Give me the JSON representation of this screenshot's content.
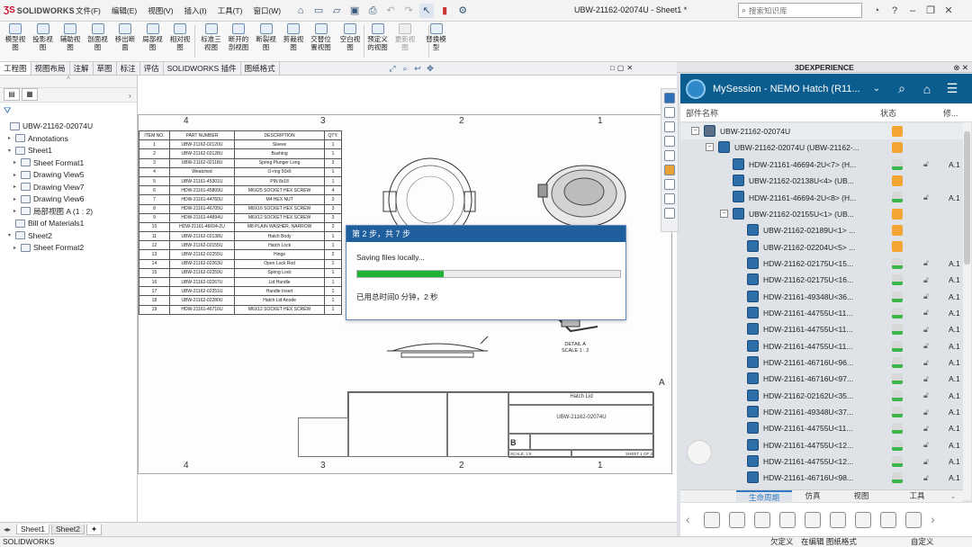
{
  "app": {
    "name": "SOLIDWORKS",
    "doc_title": "UBW-21162-02074U - Sheet1 *"
  },
  "menu": [
    "文件(F)",
    "编辑(E)",
    "视图(V)",
    "插入(I)",
    "工具(T)",
    "窗口(W)"
  ],
  "search": {
    "placeholder": "搜索知识库"
  },
  "commands": [
    {
      "label": "模型视\n图",
      "disabled": false
    },
    {
      "label": "投影视\n图",
      "disabled": false
    },
    {
      "label": "辅助视\n图",
      "disabled": false
    },
    {
      "label": "剖面视\n图",
      "disabled": false
    },
    {
      "label": "移出断\n面",
      "disabled": false
    },
    {
      "label": "局部视\n图",
      "disabled": false
    },
    {
      "label": "相对视\n图",
      "disabled": false
    },
    {
      "label": "标准三\n视图",
      "disabled": false
    },
    {
      "label": "断开的\n剖视图",
      "disabled": false
    },
    {
      "label": "断裂视\n图",
      "disabled": false
    },
    {
      "label": "剪裁视\n图",
      "disabled": false
    },
    {
      "label": "交替位\n置视图",
      "disabled": false
    },
    {
      "label": "空白视\n图",
      "disabled": false
    },
    {
      "label": "预定义\n的视图",
      "disabled": false
    },
    {
      "label": "更新视\n图",
      "disabled": true
    },
    {
      "label": "替换模\n型",
      "disabled": false
    }
  ],
  "tabs": [
    "工程图",
    "视图布局",
    "注解",
    "草图",
    "标注",
    "评估",
    "SOLIDWORKS 插件",
    "图纸格式"
  ],
  "tree": [
    {
      "label": "UBW-21162-02074U",
      "level": 0,
      "toggle": ""
    },
    {
      "label": "Annotations",
      "level": 1,
      "toggle": "▸"
    },
    {
      "label": "Sheet1",
      "level": 1,
      "toggle": "▾"
    },
    {
      "label": "Sheet Format1",
      "level": 2,
      "toggle": "▸"
    },
    {
      "label": "Drawing View5",
      "level": 2,
      "toggle": "▸"
    },
    {
      "label": "Drawing View7",
      "level": 2,
      "toggle": "▸"
    },
    {
      "label": "Drawing View6",
      "level": 2,
      "toggle": "▸"
    },
    {
      "label": "局部视图 A (1 : 2)",
      "level": 2,
      "toggle": "▸"
    },
    {
      "label": "Bill of Materials1",
      "level": 1,
      "toggle": ""
    },
    {
      "label": "Sheet2",
      "level": 1,
      "toggle": "▾"
    },
    {
      "label": "Sheet Format2",
      "level": 2,
      "toggle": "▸"
    }
  ],
  "sheet": {
    "zones_top": [
      "4",
      "3",
      "2",
      "1"
    ],
    "zone_side": "A",
    "bom_headers": [
      "ITEM NO.",
      "PART NUMBER",
      "DESCRIPTION",
      "QTY."
    ],
    "bom_rows": [
      [
        "1",
        "UBW-21162-02120U",
        "Sleeve",
        "1"
      ],
      [
        "2",
        "UBW-21162-02128U",
        "Bushing",
        "1"
      ],
      [
        "3",
        "UBW-21162-02118U",
        "Spring Plunger Long",
        "3"
      ],
      [
        "4",
        "Weatched",
        "O-ring 50x6",
        "1"
      ],
      [
        "5",
        "UBW-21161-45301U",
        "PIN 8x18",
        "1"
      ],
      [
        "6",
        "HDW-21161-45809U",
        "M6X25 SOCKET HEX SCREW",
        "4"
      ],
      [
        "7",
        "HDW-21161-44760U",
        "M4 HEX NUT",
        "3"
      ],
      [
        "8",
        "HDW-21161-46705U",
        "M8X16 SOCKET HEX SCREW",
        "3"
      ],
      [
        "9",
        "HDW-21161-44894U",
        "M6X12 SOCKET HEX SCREW",
        "3"
      ],
      [
        "10",
        "HDW-21161-46694-2U",
        "M8 PLAIN WASHER, NARROW",
        "2"
      ],
      [
        "11",
        "UBW-21162-02138U",
        "Hatch Body",
        "1"
      ],
      [
        "12",
        "UBW-21162-02155U",
        "Hatch Lock",
        "1"
      ],
      [
        "13",
        "UBW-21162-02255U",
        "Hinge",
        "2"
      ],
      [
        "14",
        "UBW-21162-02263U",
        "Open Lock Rod",
        "1"
      ],
      [
        "15",
        "UBW-21162-02259U",
        "Spring Lock",
        "1"
      ],
      [
        "16",
        "UBW-21162-02267U",
        "Lid Handle",
        "1"
      ],
      [
        "17",
        "UBW-21162-02251U",
        "Handle Insert",
        "1"
      ],
      [
        "18",
        "UBW-21162-02280U",
        "Hatch Lid Anode",
        "1"
      ],
      [
        "19",
        "HDW-21161-46716U",
        "M6X12 SOCKET HEX SCREW",
        "1"
      ]
    ],
    "detail_label": "DETAIL A\nSCALE 1 : 2",
    "title_block": {
      "title": "Hatch Lid",
      "dwg": "UBW-21162-02074U",
      "size": "B",
      "sheet": "SHEET 1 OF 2",
      "scale": "SCALE: 1:8"
    }
  },
  "dialog": {
    "title": "第 2 步，共 7 步",
    "message": "Saving files locally...",
    "progress": 0.33,
    "elapsed": "已用总时间0 分钟，2 秒"
  },
  "sheet_tabs": [
    "Sheet1",
    "Sheet2"
  ],
  "status": {
    "left": "SOLIDWORKS",
    "items": [
      "欠定义",
      "在编辑 图纸格式",
      "自定义"
    ]
  },
  "xp": {
    "panel_title": "3DEXPERIENCE",
    "session": "MySession - NEMO Hatch (R11...",
    "columns": {
      "name": "部件名称",
      "status": "状态",
      "rev": "修..."
    },
    "rows": [
      {
        "name": "UBW-21162-02074U",
        "indent": 0,
        "toggle": "−",
        "status": "lk",
        "lock": false,
        "rev": ""
      },
      {
        "name": "UBW-21162-02074U (UBW-21162-...",
        "indent": 1,
        "toggle": "−",
        "status": "lk",
        "lock": false,
        "rev": ""
      },
      {
        "name": "HDW-21161-46694-2U<7> (H...",
        "indent": 2,
        "toggle": "",
        "status": "ok",
        "lock": true,
        "rev": "A.1"
      },
      {
        "name": "UBW-21162-02138U<4> (UB...",
        "indent": 2,
        "toggle": "",
        "status": "lk",
        "lock": false,
        "rev": ""
      },
      {
        "name": "HDW-21161-46694-2U<8> (H...",
        "indent": 2,
        "toggle": "",
        "status": "ok",
        "lock": true,
        "rev": "A.1"
      },
      {
        "name": "UBW-21162-02155U<1> (UB...",
        "indent": 2,
        "toggle": "−",
        "status": "lk",
        "lock": false,
        "rev": ""
      },
      {
        "name": "UBW-21162-02189U<1> ...",
        "indent": 3,
        "toggle": "",
        "status": "lk",
        "lock": false,
        "rev": ""
      },
      {
        "name": "UBW-21162-02204U<5> ...",
        "indent": 3,
        "toggle": "",
        "status": "lk",
        "lock": false,
        "rev": ""
      },
      {
        "name": "HDW-21162-02175U<15...",
        "indent": 3,
        "toggle": "",
        "status": "ok",
        "lock": true,
        "rev": "A.1"
      },
      {
        "name": "HDW-21162-02175U<16...",
        "indent": 3,
        "toggle": "",
        "status": "ok",
        "lock": true,
        "rev": "A.1"
      },
      {
        "name": "HDW-21161-49348U<36...",
        "indent": 3,
        "toggle": "",
        "status": "ok",
        "lock": true,
        "rev": "A.1"
      },
      {
        "name": "HDW-21161-44755U<11...",
        "indent": 3,
        "toggle": "",
        "status": "ok",
        "lock": true,
        "rev": "A.1"
      },
      {
        "name": "HDW-21161-44755U<11...",
        "indent": 3,
        "toggle": "",
        "status": "ok",
        "lock": true,
        "rev": "A.1"
      },
      {
        "name": "HDW-21161-44755U<11...",
        "indent": 3,
        "toggle": "",
        "status": "ok",
        "lock": true,
        "rev": "A.1"
      },
      {
        "name": "HDW-21161-46716U<96...",
        "indent": 3,
        "toggle": "",
        "status": "ok",
        "lock": true,
        "rev": "A.1"
      },
      {
        "name": "HDW-21161-46716U<97...",
        "indent": 3,
        "toggle": "",
        "status": "ok",
        "lock": true,
        "rev": "A.1"
      },
      {
        "name": "HDW-21162-02162U<35...",
        "indent": 3,
        "toggle": "",
        "status": "ok",
        "lock": true,
        "rev": "A.1"
      },
      {
        "name": "HDW-21161-49348U<37...",
        "indent": 3,
        "toggle": "",
        "status": "ok",
        "lock": true,
        "rev": "A.1"
      },
      {
        "name": "HDW-21161-44755U<11...",
        "indent": 3,
        "toggle": "",
        "status": "ok",
        "lock": true,
        "rev": "A.1"
      },
      {
        "name": "HDW-21161-44755U<12...",
        "indent": 3,
        "toggle": "",
        "status": "ok",
        "lock": true,
        "rev": "A.1"
      },
      {
        "name": "HDW-21161-44755U<12...",
        "indent": 3,
        "toggle": "",
        "status": "ok",
        "lock": true,
        "rev": "A.1"
      },
      {
        "name": "HDW-21161-46716U<98...",
        "indent": 3,
        "toggle": "",
        "status": "ok",
        "lock": true,
        "rev": "A.1"
      }
    ],
    "bottom_tabs": [
      "生命周期",
      "仿真",
      "视图",
      "工具"
    ]
  },
  "colors": {
    "accent": "#1f5f9e",
    "progress": "#1fb437",
    "xp_header": "#0b5d8f",
    "brand_red": "#c8102e"
  }
}
